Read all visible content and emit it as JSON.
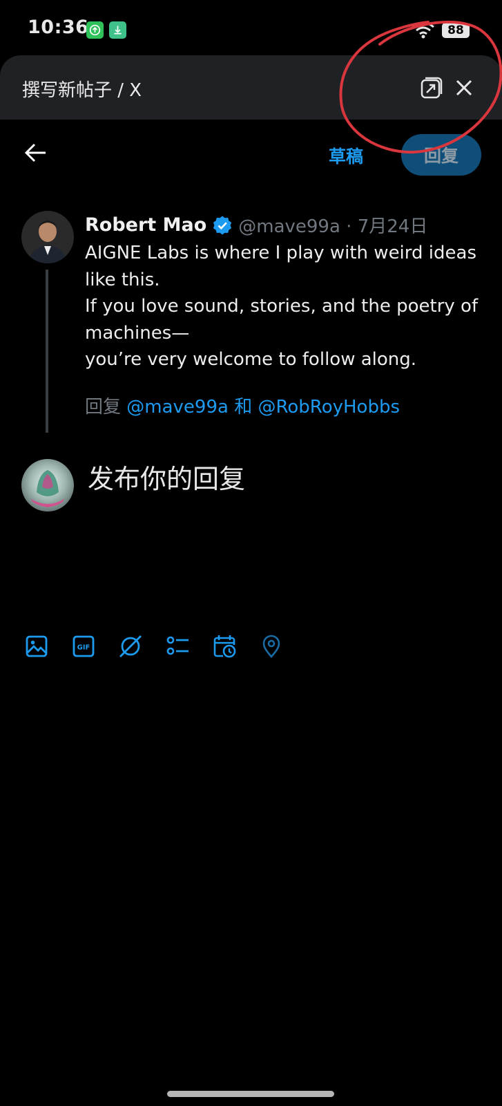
{
  "status_bar": {
    "time": "10:36",
    "battery": "88",
    "notification_icons": [
      "upload-app-icon",
      "download-app-icon"
    ]
  },
  "browser": {
    "title": "撰写新帖子 / X",
    "icons": [
      "open-external-icon",
      "close-icon"
    ]
  },
  "compose_header": {
    "drafts_label": "草稿",
    "reply_label": "回复"
  },
  "tweet": {
    "author": "Robert Mao",
    "handle_date": "@mave99a · 7月24日",
    "lines": [
      "AIGNE Labs is where I play with weird ideas",
      "like this.",
      "If you love sound, stories, and the poetry of",
      "machines—",
      "you’re very welcome to follow along."
    ],
    "reply_prefix": "回复",
    "mention_1": "@mave99a",
    "conjunction": "和",
    "mention_2": "@RobRoyHobbs"
  },
  "reply": {
    "placeholder": "发布你的回复"
  },
  "toolbar": [
    "image-icon",
    "gif-icon",
    "grok-icon",
    "poll-icon",
    "schedule-icon",
    "location-icon"
  ],
  "colors": {
    "background": "#000000",
    "accent": "#1d9bf0",
    "reply_button_bg": "#0f4e78",
    "muted_text": "#717880",
    "annotation": "#d9363e"
  }
}
